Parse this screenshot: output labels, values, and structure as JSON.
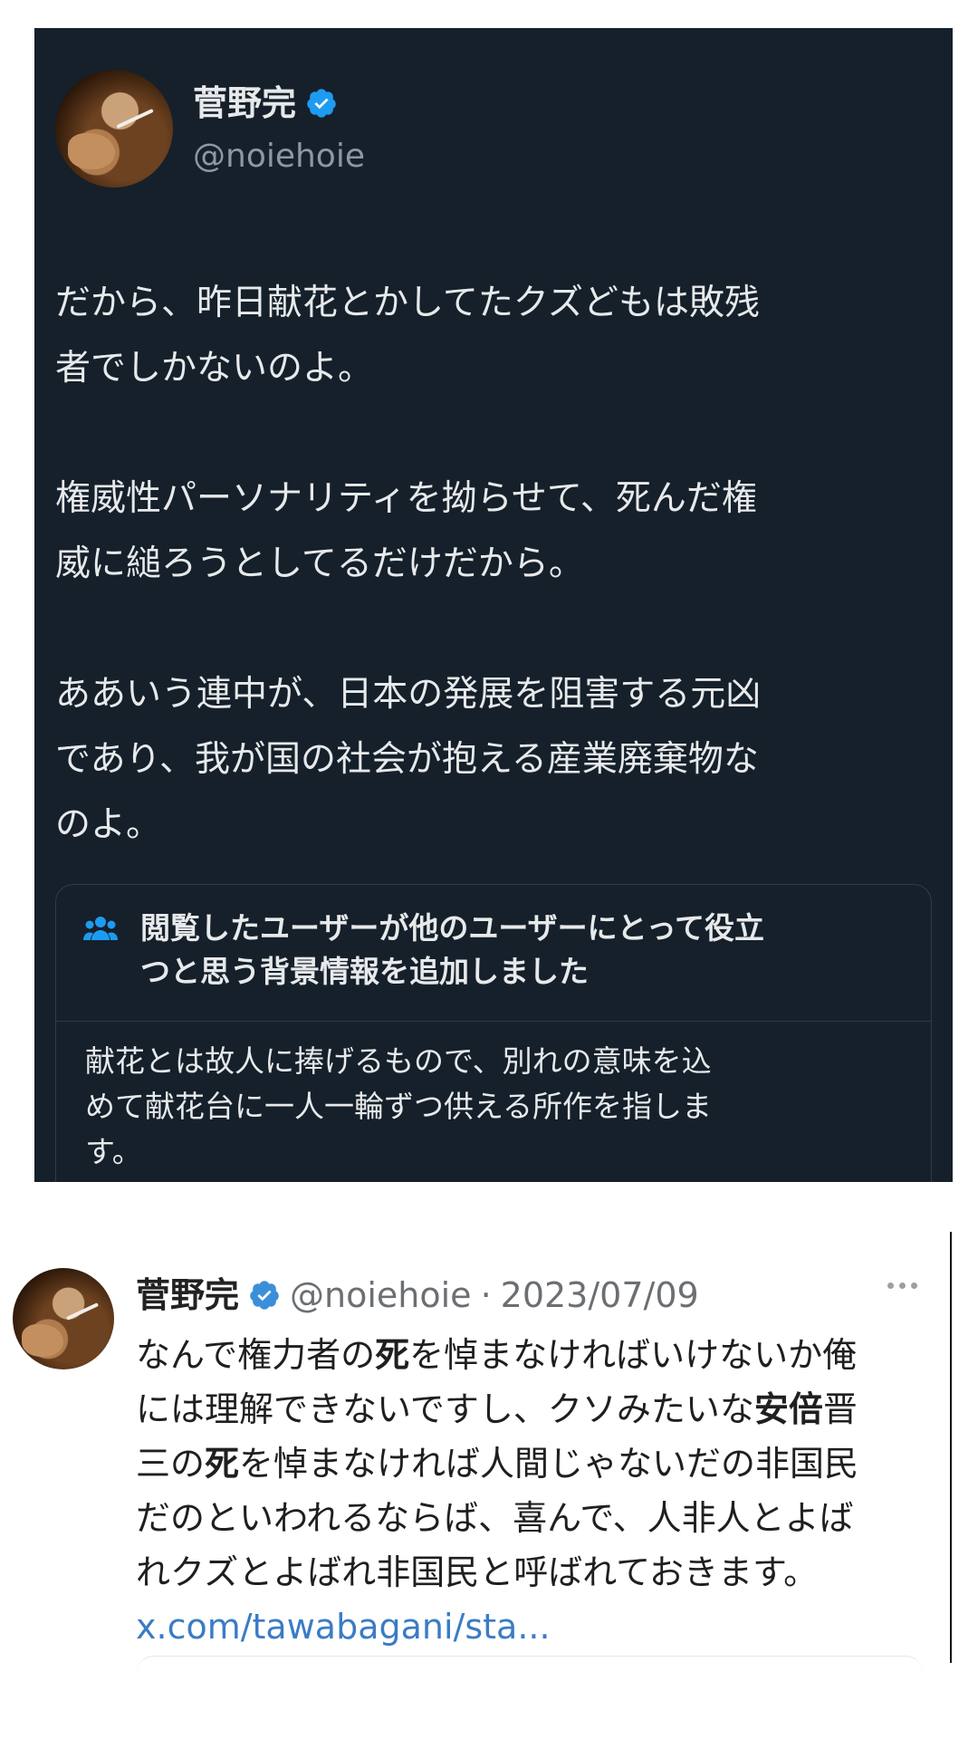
{
  "top_tweet": {
    "display_name": "菅野完",
    "handle": "@noiehoie",
    "paragraphs": [
      "だから、昨日献花とかしてたクズどもは敗残\n者でしかないのよ。",
      "権威性パーソナリティを拗らせて、死んだ権\n威に縋ろうとしてるだけだから。",
      "ああいう連中が、日本の発展を阻害する元凶\nであり、我が国の社会が抱える産業廃棄物な\nのよ。"
    ],
    "community_note": {
      "icon": "people-icon",
      "title": "閲覧したユーザーが他のユーザーにとって役立\nつと思う背景情報を追加しました",
      "body": "献花とは故人に捧げるもので、別れの意味を込\nめて献花台に一人一輪ずつ供える所作を指しま\nす。"
    },
    "colors": {
      "background": "#15202b",
      "text": "#e7e9ea",
      "muted": "#8b98a5",
      "verified": "#1d9bf0"
    }
  },
  "bottom_tweet": {
    "display_name": "菅野完",
    "handle": "@noiehoie",
    "separator": "·",
    "date": "2023/07/09",
    "lines": [
      [
        "なんで権力者の",
        "死",
        "を悼まなければいけないか俺"
      ],
      [
        "には理解できないですし、クソみたいな",
        "安倍",
        "晋"
      ],
      [
        "三の",
        "死",
        "を悼まなければ人間じゃないだの非国民"
      ],
      [
        "だのといわれるならば、喜んで、人非人とよば",
        "",
        ""
      ],
      [
        "れクズとよばれ非国民と呼ばれておきます。",
        "",
        ""
      ]
    ],
    "link": "x.com/tawabagani/sta...",
    "colors": {
      "link": "#3b7cc4",
      "muted": "#6b6f73"
    }
  }
}
